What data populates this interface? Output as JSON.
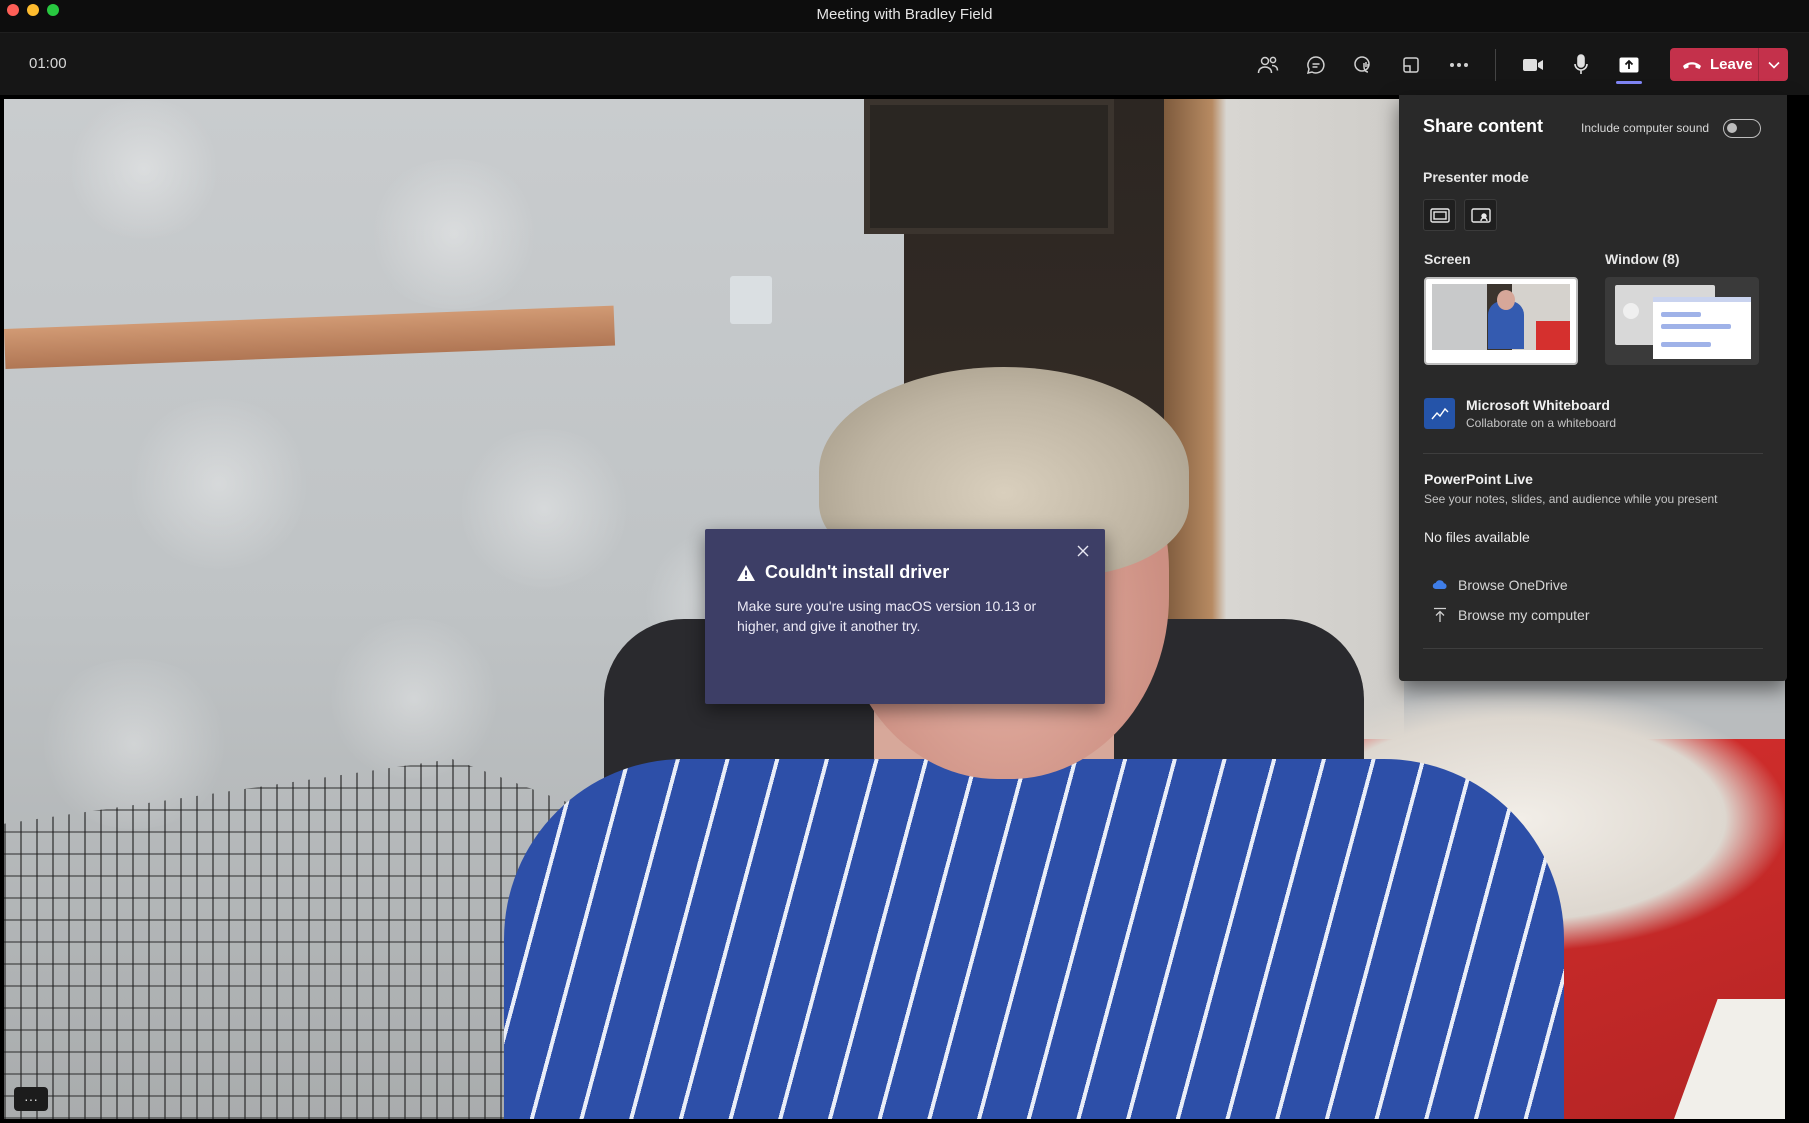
{
  "window": {
    "title": "Meeting with Bradley Field"
  },
  "toolbar": {
    "timer": "01:00",
    "leave_label": "Leave"
  },
  "dialog": {
    "title": "Couldn't install driver",
    "message": "Make sure you're using macOS version 10.13 or higher, and give it another try."
  },
  "share": {
    "title": "Share content",
    "include_sound_label": "Include computer sound",
    "include_sound_on": false,
    "presenter_mode_label": "Presenter mode",
    "screen_label": "Screen",
    "window_label": "Window (8)",
    "whiteboard": {
      "title": "Microsoft Whiteboard",
      "subtitle": "Collaborate on a whiteboard"
    },
    "powerpoint": {
      "title": "PowerPoint Live",
      "subtitle": "See your notes, slides, and audience while you present"
    },
    "no_files": "No files available",
    "browse_onedrive": "Browse OneDrive",
    "browse_computer": "Browse my computer"
  },
  "video": {
    "more_label": "···"
  },
  "colors": {
    "leave": "#c4314b",
    "accent": "#7f85f5",
    "dialog_bg": "#3d3e66",
    "panel_bg": "#292929"
  }
}
